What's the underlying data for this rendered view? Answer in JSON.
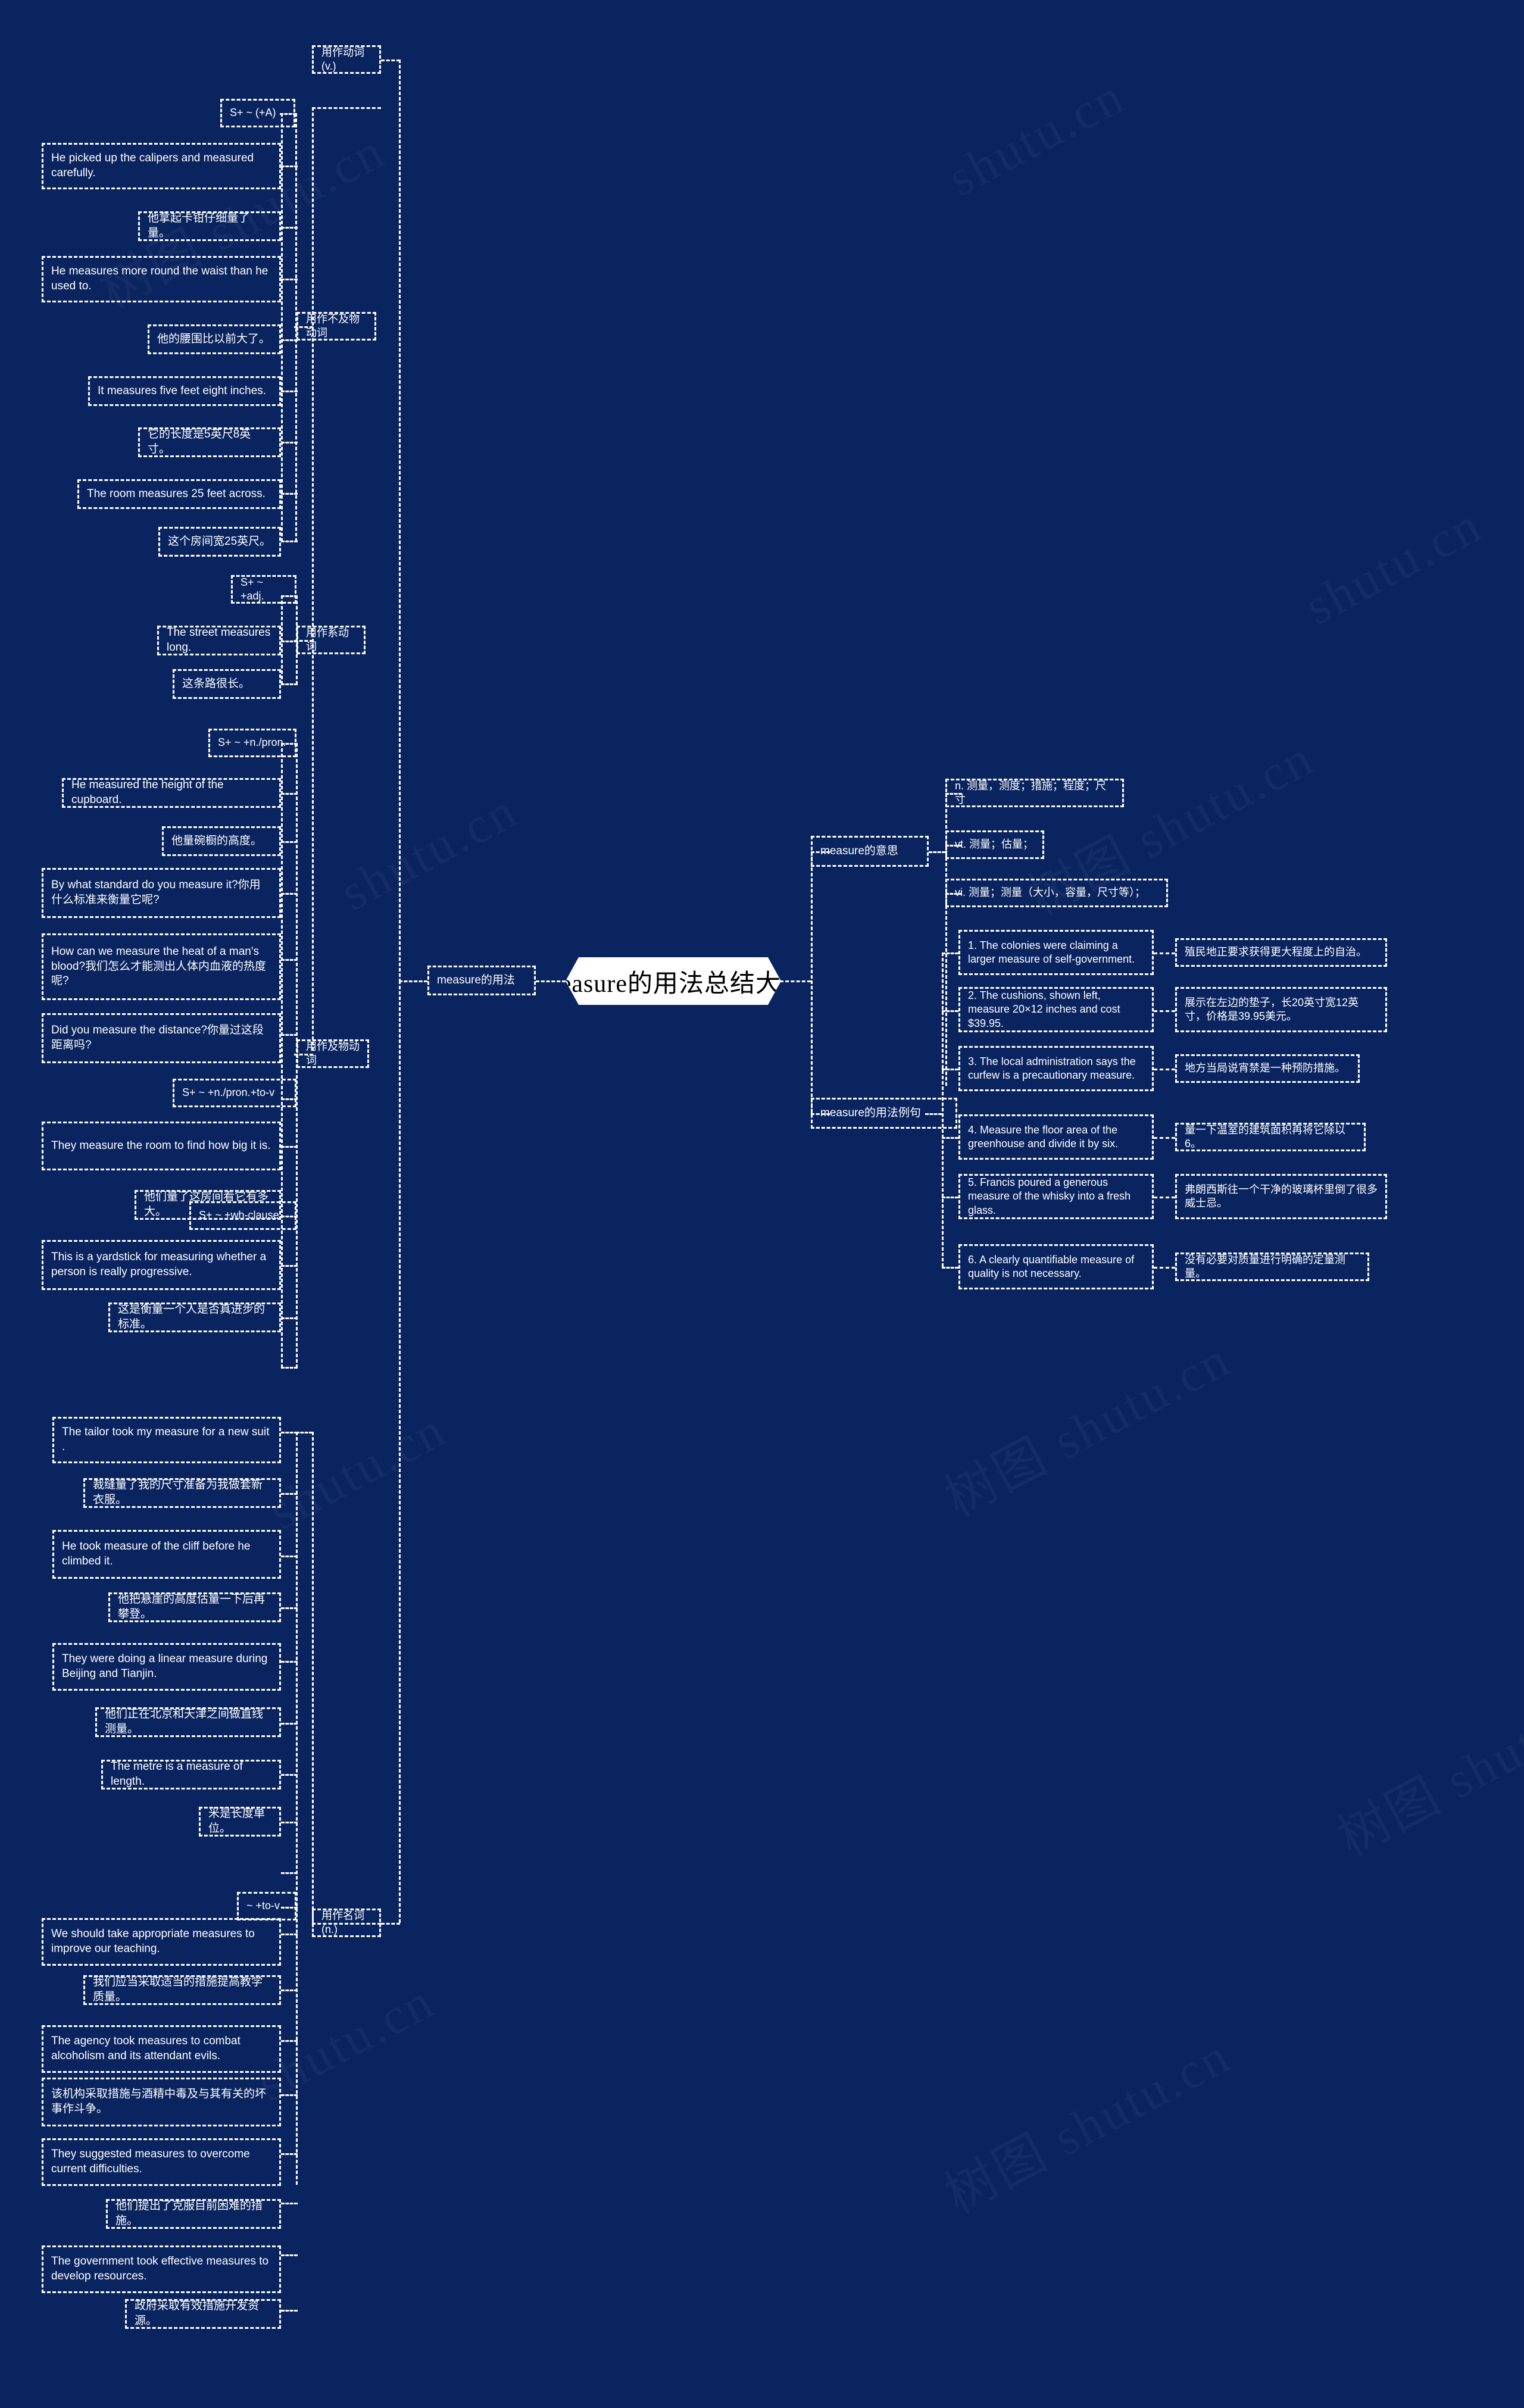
{
  "root": {
    "title": "measure的用法总结大全"
  },
  "branches": {
    "usage": {
      "label": "measure的用法"
    },
    "meaning": {
      "label": "measure的意思"
    },
    "examples": {
      "label": "measure的用法例句"
    }
  },
  "pos_groups": {
    "verb": "用作动词(v.)",
    "noun": "用作名词(n.)",
    "intransitive": "用作不及物动词",
    "linking": "用作系动词",
    "transitive": "用作及物动词"
  },
  "patterns": {
    "p1": "S+ ~ (+A)",
    "p2": "S+ ~ +adj.",
    "p3": "S+ ~ +n./pron.",
    "p4": "S+ ~ +n./pron.+to-v",
    "p5": "S+ ~ +wh-clause",
    "p6": "~ +to-v"
  },
  "meanings": [
    "n. 测量，测度；措施；程度；尺寸",
    "vt. 测量；估量；",
    "vi. 测量；测量（大小，容量，尺寸等）；"
  ],
  "intransitive_examples": [
    {
      "en": "He picked up the calipers and measured carefully.",
      "zh": "他拿起卡钳仔细量了量。"
    },
    {
      "en": "He measures more round the waist than he used to.",
      "zh": "他的腰围比以前大了。"
    },
    {
      "en": "It measures five feet eight inches.",
      "zh": "它的长度是5英尺8英寸。"
    },
    {
      "en": "The room measures 25 feet across.",
      "zh": "这个房间宽25英尺。"
    }
  ],
  "linking_examples": [
    {
      "en": "The street measures long.",
      "zh": "这条路很长。"
    }
  ],
  "transitive_examples": [
    {
      "en": "He measured the height of the cupboard.",
      "zh": "他量碗橱的高度。"
    },
    {
      "en": "By what standard do you measure it?你用什么标准来衡量它呢?",
      "zh": ""
    },
    {
      "en": "How can we measure the heat of a man's blood?我们怎么才能测出人体内血液的热度呢?",
      "zh": ""
    },
    {
      "en": "Did you measure the distance?你量过这段距离吗?",
      "zh": ""
    },
    {
      "en": "They measure the room to find how big it is.",
      "zh": "他们量了这房间看它有多大。"
    },
    {
      "en": "This is a yardstick for measuring whether a person is really progressive.",
      "zh": "这是衡量一个人是否真进步的标准。"
    }
  ],
  "noun_examples": [
    {
      "en": "The tailor took my measure for a new suit .",
      "zh": "裁缝量了我的尺寸准备为我做套新衣服。"
    },
    {
      "en": "He took measure of the cliff before he climbed it.",
      "zh": "他把悬崖的高度估量一下后再攀登。"
    },
    {
      "en": "They were doing a linear measure during Beijing and Tianjin.",
      "zh": "他们正在北京和天津之间做直线测量。"
    },
    {
      "en": "The metre is a measure of length.",
      "zh": "米是长度单位。"
    }
  ],
  "noun_tov_examples": [
    {
      "en": "We should take appropriate measures to improve our teaching.",
      "zh": "我们应当采取适当的措施提高教学质量。"
    },
    {
      "en": "The agency took measures to combat alcoholism and its attendant evils.",
      "zh": "该机构采取措施与酒精中毒及与其有关的坏事作斗争。"
    },
    {
      "en": "They suggested measures to overcome current difficulties.",
      "zh": "他们提出了克服目前困难的措施。"
    },
    {
      "en": "The government took effective measures to develop resources.",
      "zh": "政府采取有效措施开发资源。"
    }
  ],
  "example_sentences": [
    {
      "en": "1. The colonies were claiming a larger measure of self-government.",
      "zh": "殖民地正要求获得更大程度上的自治。"
    },
    {
      "en": "2. The cushions, shown left, measure 20×12 inches and cost $39.95.",
      "zh": "展示在左边的垫子，长20英寸宽12英寸，价格是39.95美元。"
    },
    {
      "en": "3. The local administration says the curfew is a precautionary measure.",
      "zh": "地方当局说宵禁是一种预防措施。"
    },
    {
      "en": "4. Measure the floor area of the greenhouse and divide it by six.",
      "zh": "量一下温室的建筑面积再将它除以6。"
    },
    {
      "en": "5. Francis poured a generous measure of the whisky into a fresh glass.",
      "zh": "弗朗西斯往一个干净的玻璃杯里倒了很多威士忌。"
    },
    {
      "en": "6. A clearly quantifiable measure of quality is not necessary.",
      "zh": "没有必要对质量进行明确的定量测量。"
    }
  ],
  "watermarks": [
    "树图 shutu.cn",
    "shutu.cn",
    "树图 shutu.cn",
    "shutu.cn",
    "shutu.cn",
    "树图 shutu.cn",
    "shutu.cn",
    "树图 shutu.cn",
    "shutu.cn",
    "树图 shutu.cn"
  ],
  "colors": {
    "background": "#0a2460",
    "node_border": "#ffffff",
    "root_background": "#ffffff",
    "root_text": "#000000"
  }
}
